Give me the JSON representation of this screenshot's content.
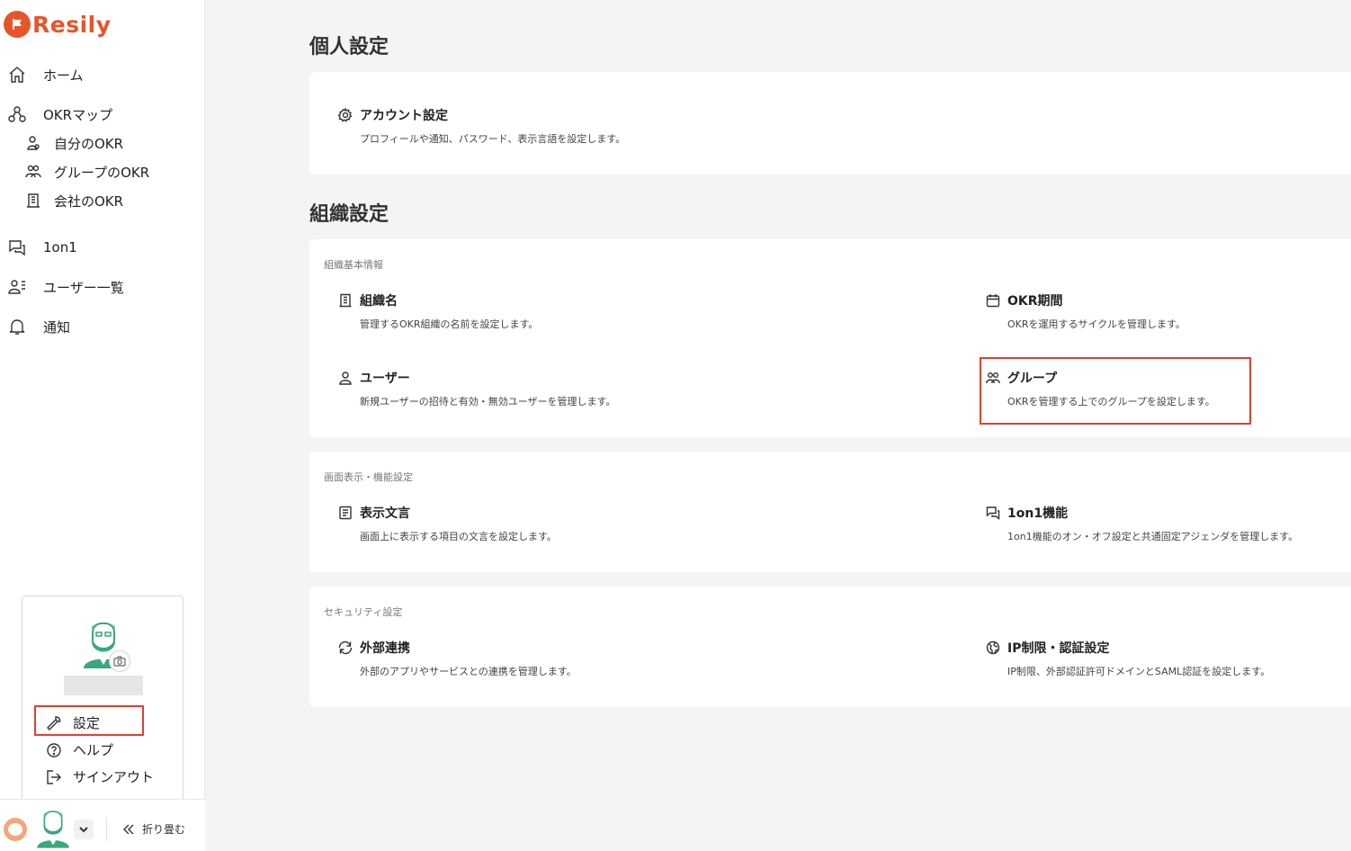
{
  "brand": {
    "name": "Resily",
    "color": "#e8542a"
  },
  "sidebar": {
    "home": "ホーム",
    "okr_map": "OKRマップ",
    "my_okr": "自分のOKR",
    "group_okr": "グループのOKR",
    "company_okr": "会社のOKR",
    "one_on_one": "1on1",
    "users": "ユーザー一覧",
    "notifications": "通知"
  },
  "popup": {
    "settings": "設定",
    "help": "ヘルプ",
    "signout": "サインアウト"
  },
  "bottom": {
    "collapse": "折り畳む"
  },
  "personal": {
    "title": "個人設定",
    "account": {
      "title": "アカウント設定",
      "desc": "プロフィールや通知、パスワード、表示言語を設定します。"
    }
  },
  "org": {
    "title": "組織設定",
    "basic": {
      "label": "組織基本情報",
      "org_name": {
        "title": "組織名",
        "desc": "管理するOKR組織の名前を設定します。"
      },
      "okr_period": {
        "title": "OKR期間",
        "desc": "OKRを運用するサイクルを管理します。"
      },
      "user": {
        "title": "ユーザー",
        "desc": "新規ユーザーの招待と有効・無効ユーザーを管理します。"
      },
      "group": {
        "title": "グループ",
        "desc": "OKRを管理する上でのグループを設定します。"
      }
    },
    "display": {
      "label": "画面表示・機能設定",
      "text": {
        "title": "表示文言",
        "desc": "画面上に表示する項目の文言を設定します。"
      },
      "one_on_one": {
        "title": "1on1機能",
        "desc": "1on1機能のオン・オフ設定と共通固定アジェンダを管理します。"
      }
    },
    "security": {
      "label": "セキュリティ設定",
      "external": {
        "title": "外部連携",
        "desc": "外部のアプリやサービスとの連携を管理します。"
      },
      "ip": {
        "title": "IP制限・認証設定",
        "desc": "IP制限、外部認証許可ドメインとSAML認証を設定します。"
      }
    }
  },
  "colors": {
    "highlight": "#e2402b",
    "avatar_green": "#3aa87a"
  }
}
